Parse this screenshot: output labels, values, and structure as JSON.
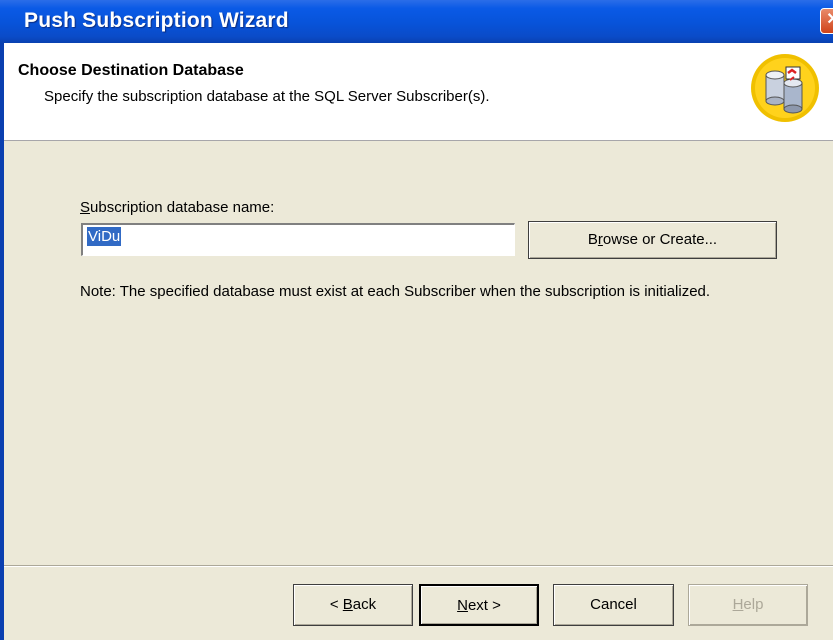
{
  "window": {
    "title": "Push Subscription Wizard",
    "close_glyph": "✕"
  },
  "header": {
    "title": "Choose Destination Database",
    "subtitle": "Specify the subscription database at the SQL Server Subscriber(s).",
    "icon": "database-icon"
  },
  "form": {
    "label_mnemonic": "S",
    "label_rest": "ubscription database name:",
    "db_name_value": "ViDu",
    "browse_mnemonic_pre": "B",
    "browse_mnemonic": "r",
    "browse_rest": "owse or Create...",
    "note": "Note: The specified database must exist at each Subscriber when the subscription is initialized."
  },
  "footer": {
    "back_prefix": "< ",
    "back_mnemonic": "B",
    "back_rest": "ack",
    "next_mnemonic": "N",
    "next_rest": "ext >",
    "cancel": "Cancel",
    "help_mnemonic": "H",
    "help_rest": "elp"
  },
  "colors": {
    "accent": "#0a5ae6",
    "selection": "#316ac5",
    "dialog_bg": "#ece9d8"
  }
}
